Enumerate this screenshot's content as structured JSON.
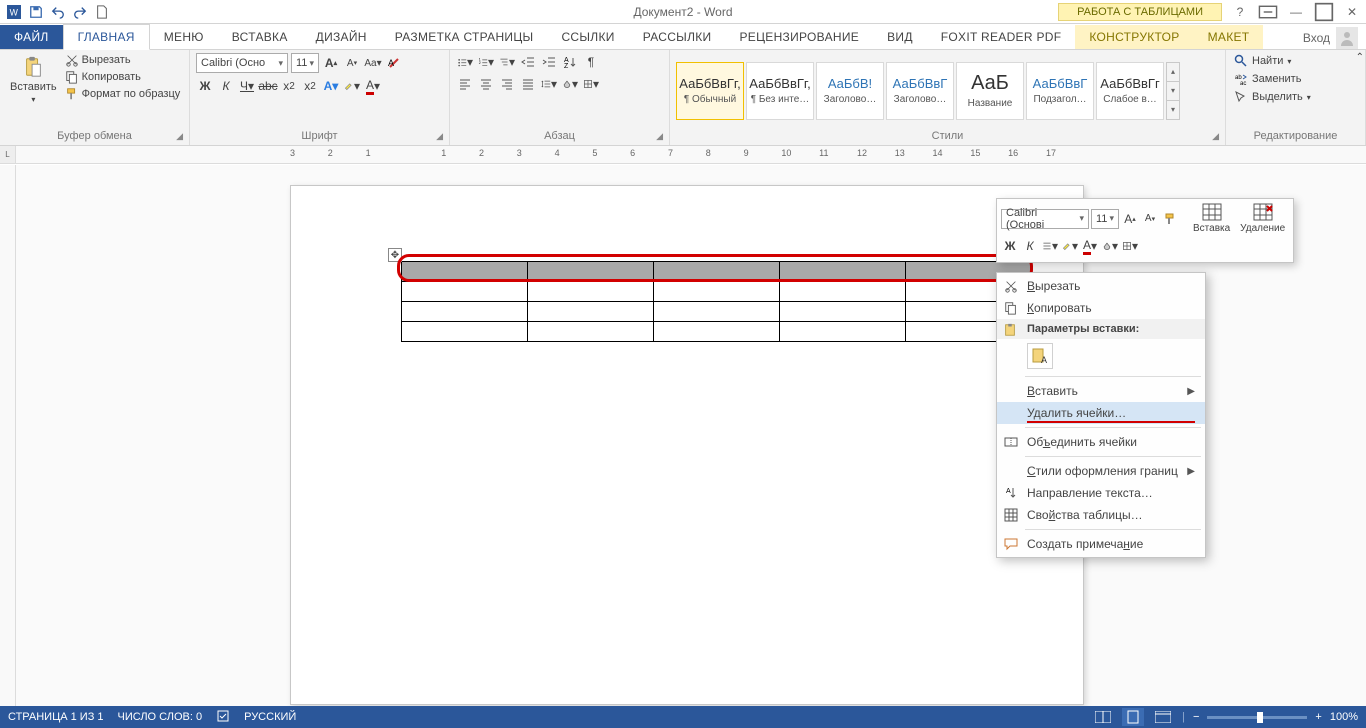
{
  "qat": {
    "title": "Документ2 - Word",
    "table_tools": "РАБОТА С ТАБЛИЦАМИ"
  },
  "tabs": {
    "file": "ФАЙЛ",
    "home": "ГЛАВНАЯ",
    "menu": "Меню",
    "insert": "ВСТАВКА",
    "design": "ДИЗАЙН",
    "layout": "РАЗМЕТКА СТРАНИЦЫ",
    "references": "ССЫЛКИ",
    "mailings": "РАССЫЛКИ",
    "review": "РЕЦЕНЗИРОВАНИЕ",
    "view": "ВИД",
    "foxit": "Foxit Reader PDF",
    "constructor": "КОНСТРУКТОР",
    "layout2": "МАКЕТ",
    "signin": "Вход"
  },
  "ribbon": {
    "clipboard": {
      "label": "Буфер обмена",
      "paste": "Вставить",
      "cut": "Вырезать",
      "copy": "Копировать",
      "format_painter": "Формат по образцу"
    },
    "font": {
      "label": "Шрифт",
      "name": "Calibri (Осно",
      "size": "11"
    },
    "paragraph": {
      "label": "Абзац"
    },
    "styles": {
      "label": "Стили",
      "items": [
        {
          "preview": "АаБбВвГг,",
          "caption": "¶ Обычный"
        },
        {
          "preview": "АаБбВвГг,",
          "caption": "¶ Без инте…"
        },
        {
          "preview": "АаБбВ!",
          "caption": "Заголово…"
        },
        {
          "preview": "АаБбВвГ",
          "caption": "Заголово…"
        },
        {
          "preview": "АаБ",
          "caption": "Название"
        },
        {
          "preview": "АаБбВвГ",
          "caption": "Подзагол…"
        },
        {
          "preview": "АаБбВвГг",
          "caption": "Слабое в…"
        }
      ]
    },
    "editing": {
      "label": "Редактирование",
      "find": "Найти",
      "replace": "Заменить",
      "select": "Выделить"
    }
  },
  "ruler_marks": [
    "3",
    "2",
    "1",
    "",
    "1",
    "2",
    "3",
    "4",
    "5",
    "6",
    "7",
    "8",
    "9",
    "10",
    "11",
    "12",
    "13",
    "14",
    "15",
    "16",
    "17"
  ],
  "mini_toolbar": {
    "font": "Calibri (Основі",
    "size": "11",
    "insert": "Вставка",
    "delete": "Удаление"
  },
  "context": {
    "cut": "Вырезать",
    "copy": "Копировать",
    "paste_header": "Параметры вставки:",
    "insert": "Вставить",
    "delete_cells": "Удалить ячейки…",
    "merge": "Объединить ячейки",
    "border_styles": "Стили оформления границ",
    "text_direction": "Направление текста…",
    "table_props": "Свойства таблицы…",
    "new_comment": "Создать примечание"
  },
  "status": {
    "page": "СТРАНИЦА 1 ИЗ 1",
    "words": "ЧИСЛО СЛОВ: 0",
    "lang": "РУССКИЙ",
    "zoom": "100%"
  }
}
